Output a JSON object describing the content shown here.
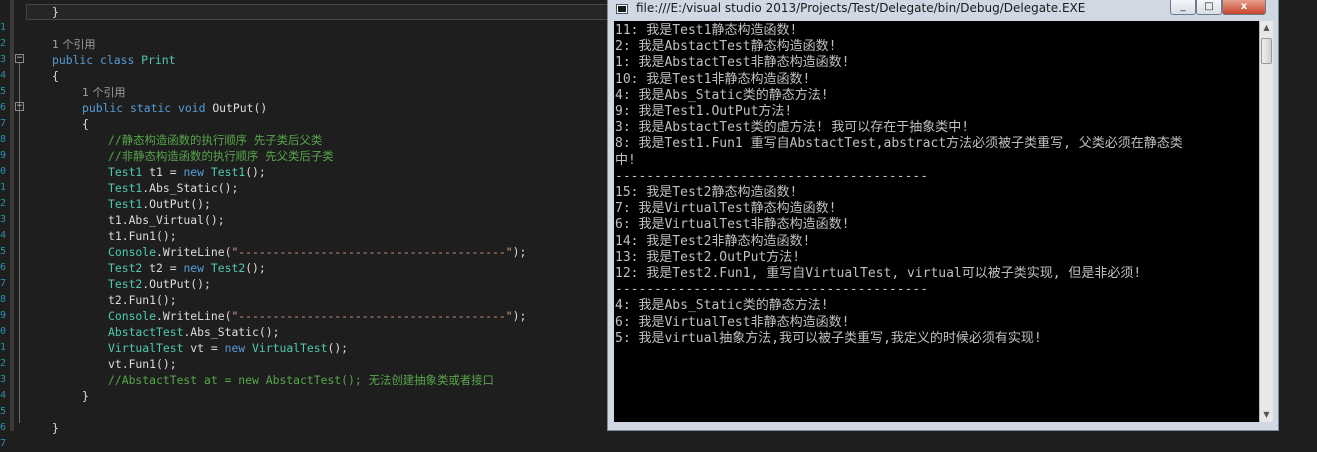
{
  "editor": {
    "line_numbers": [
      "",
      "1",
      "2",
      "3",
      "4",
      "5",
      "6",
      "7",
      "8",
      "9",
      "0",
      "1",
      "2",
      "3",
      "4",
      "5",
      "6",
      "7",
      "8",
      "9",
      "0",
      "1",
      "2",
      "3",
      "4",
      "5",
      "6",
      "7"
    ],
    "lines": [
      {
        "tokens": [
          {
            "t": "tx",
            "v": "}"
          }
        ],
        "indent": 52
      },
      {
        "tokens": [],
        "indent": 52
      },
      {
        "tokens": [
          {
            "t": "ref",
            "v": "1 个引用"
          }
        ],
        "indent": 52
      },
      {
        "tokens": [
          {
            "t": "kw",
            "v": "public"
          },
          {
            "t": "tx",
            "v": " "
          },
          {
            "t": "kw",
            "v": "class"
          },
          {
            "t": "tx",
            "v": " "
          },
          {
            "t": "ty",
            "v": "Print"
          }
        ],
        "indent": 52
      },
      {
        "tokens": [
          {
            "t": "tx",
            "v": "{"
          }
        ],
        "indent": 52
      },
      {
        "tokens": [
          {
            "t": "ref",
            "v": "1 个引用"
          }
        ],
        "indent": 82
      },
      {
        "tokens": [
          {
            "t": "kw",
            "v": "public"
          },
          {
            "t": "tx",
            "v": " "
          },
          {
            "t": "kw",
            "v": "static"
          },
          {
            "t": "tx",
            "v": " "
          },
          {
            "t": "kw",
            "v": "void"
          },
          {
            "t": "tx",
            "v": " OutPut()"
          }
        ],
        "indent": 82
      },
      {
        "tokens": [
          {
            "t": "tx",
            "v": "{"
          }
        ],
        "indent": 82
      },
      {
        "tokens": [
          {
            "t": "cm",
            "v": "//静态构造函数的执行顺序 先子类后父类"
          }
        ],
        "indent": 108
      },
      {
        "tokens": [
          {
            "t": "cm",
            "v": "//非静态构造函数的执行顺序 先父类后子类"
          }
        ],
        "indent": 108
      },
      {
        "tokens": [
          {
            "t": "ty",
            "v": "Test1"
          },
          {
            "t": "tx",
            "v": " t1 = "
          },
          {
            "t": "kw",
            "v": "new"
          },
          {
            "t": "tx",
            "v": " "
          },
          {
            "t": "ty",
            "v": "Test1"
          },
          {
            "t": "tx",
            "v": "();"
          }
        ],
        "indent": 108
      },
      {
        "tokens": [
          {
            "t": "ty",
            "v": "Test1"
          },
          {
            "t": "tx",
            "v": ".Abs_Static();"
          }
        ],
        "indent": 108
      },
      {
        "tokens": [
          {
            "t": "ty",
            "v": "Test1"
          },
          {
            "t": "tx",
            "v": ".OutPut();"
          }
        ],
        "indent": 108
      },
      {
        "tokens": [
          {
            "t": "tx",
            "v": "t1.Abs_Virtual();"
          }
        ],
        "indent": 108
      },
      {
        "tokens": [
          {
            "t": "tx",
            "v": "t1.Fun1();"
          }
        ],
        "indent": 108
      },
      {
        "tokens": [
          {
            "t": "ty",
            "v": "Console"
          },
          {
            "t": "tx",
            "v": ".WriteLine("
          },
          {
            "t": "st",
            "v": "\"---------------------------------------\""
          },
          {
            "t": "tx",
            "v": ");"
          }
        ],
        "indent": 108
      },
      {
        "tokens": [
          {
            "t": "ty",
            "v": "Test2"
          },
          {
            "t": "tx",
            "v": " t2 = "
          },
          {
            "t": "kw",
            "v": "new"
          },
          {
            "t": "tx",
            "v": " "
          },
          {
            "t": "ty",
            "v": "Test2"
          },
          {
            "t": "tx",
            "v": "();"
          }
        ],
        "indent": 108
      },
      {
        "tokens": [
          {
            "t": "ty",
            "v": "Test2"
          },
          {
            "t": "tx",
            "v": ".OutPut();"
          }
        ],
        "indent": 108
      },
      {
        "tokens": [
          {
            "t": "tx",
            "v": "t2.Fun1();"
          }
        ],
        "indent": 108
      },
      {
        "tokens": [
          {
            "t": "ty",
            "v": "Console"
          },
          {
            "t": "tx",
            "v": ".WriteLine("
          },
          {
            "t": "st",
            "v": "\"---------------------------------------\""
          },
          {
            "t": "tx",
            "v": ");"
          }
        ],
        "indent": 108
      },
      {
        "tokens": [
          {
            "t": "ty",
            "v": "AbstactTest"
          },
          {
            "t": "tx",
            "v": ".Abs_Static();"
          }
        ],
        "indent": 108
      },
      {
        "tokens": [
          {
            "t": "ty",
            "v": "VirtualTest"
          },
          {
            "t": "tx",
            "v": " vt = "
          },
          {
            "t": "kw",
            "v": "new"
          },
          {
            "t": "tx",
            "v": " "
          },
          {
            "t": "ty",
            "v": "VirtualTest"
          },
          {
            "t": "tx",
            "v": "();"
          }
        ],
        "indent": 108
      },
      {
        "tokens": [
          {
            "t": "tx",
            "v": "vt.Fun1();"
          }
        ],
        "indent": 108
      },
      {
        "tokens": [
          {
            "t": "cm",
            "v": "//AbstactTest at = new AbstactTest(); 无法创建抽象类或者接口"
          }
        ],
        "indent": 108
      },
      {
        "tokens": [
          {
            "t": "tx",
            "v": "}"
          }
        ],
        "indent": 82
      },
      {
        "tokens": [],
        "indent": 52
      },
      {
        "tokens": [
          {
            "t": "tx",
            "v": "}"
          }
        ],
        "indent": 52
      }
    ]
  },
  "console": {
    "title": "file:///E:/visual studio 2013/Projects/Test/Delegate/bin/Debug/Delegate.EXE",
    "min_label": "_",
    "max_label": "□",
    "close_label": "x",
    "scroll_up": "▲",
    "scroll_down": "▼",
    "output": [
      "11: 我是Test1静态构造函数!",
      "2: 我是AbstactTest静态构造函数!",
      "1: 我是AbstactTest非静态构造函数!",
      "10: 我是Test1非静态构造函数!",
      "4: 我是Abs_Static类的静态方法!",
      "9: 我是Test1.OutPut方法!",
      "3: 我是AbstactTest类的虚方法! 我可以存在于抽象类中!",
      "8: 我是Test1.Fun1 重写自AbstactTest,abstract方法必须被子类重写, 父类必须在静态类",
      "中!",
      "----------------------------------------",
      "15: 我是Test2静态构造函数!",
      "7: 我是VirtualTest静态构造函数!",
      "6: 我是VirtualTest非静态构造函数!",
      "14: 我是Test2非静态构造函数!",
      "13: 我是Test2.OutPut方法!",
      "12: 我是Test2.Fun1, 重写自VirtualTest, virtual可以被子类实现, 但是非必须!",
      "----------------------------------------",
      "4: 我是Abs_Static类的静态方法!",
      "6: 我是VirtualTest非静态构造函数!",
      "5: 我是virtual抽象方法,我可以被子类重写,我定义的时候必须有实现!"
    ]
  },
  "colors": {
    "keyword": "#569cd6",
    "type": "#4ec9b0",
    "comment": "#57a64a",
    "string": "#d69d85",
    "text": "#dcdcdc",
    "console_bg": "#000000",
    "console_text": "#c0c0c0"
  }
}
